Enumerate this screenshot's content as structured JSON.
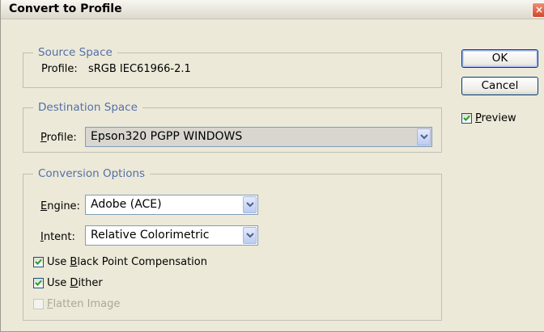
{
  "window": {
    "title": "Convert to Profile",
    "close_glyph": "×"
  },
  "source": {
    "legend": "Source Space",
    "profile_label": "Profile:",
    "profile_value": "sRGB IEC61966-2.1"
  },
  "destination": {
    "legend": "Destination Space",
    "profile_label_mnemonic": "P",
    "profile_label_rest": "rofile:",
    "profile_value": "Epson320 PGPP WINDOWS"
  },
  "conversion": {
    "legend": "Conversion Options",
    "engine_label_mnemonic": "E",
    "engine_label_rest": "ngine:",
    "engine_value": "Adobe (ACE)",
    "intent_label_mnemonic": "I",
    "intent_label_rest": "ntent:",
    "intent_value": "Relative Colorimetric",
    "black_point": {
      "pre": "Use ",
      "mnemonic": "B",
      "rest": "lack Point Compensation",
      "checked": true
    },
    "dither": {
      "pre": "Use ",
      "mnemonic": "D",
      "rest": "ither",
      "checked": true
    },
    "flatten": {
      "mnemonic": "F",
      "rest": "latten Image",
      "checked": false,
      "disabled": true
    }
  },
  "buttons": {
    "ok": "OK",
    "cancel": "Cancel"
  },
  "preview": {
    "mnemonic": "P",
    "rest": "review",
    "checked": true
  },
  "colors": {
    "dialog_bg": "#ece9d8",
    "legend_text": "#5470a8",
    "check_mark": "#21a121",
    "disabled_text": "#aca899"
  }
}
